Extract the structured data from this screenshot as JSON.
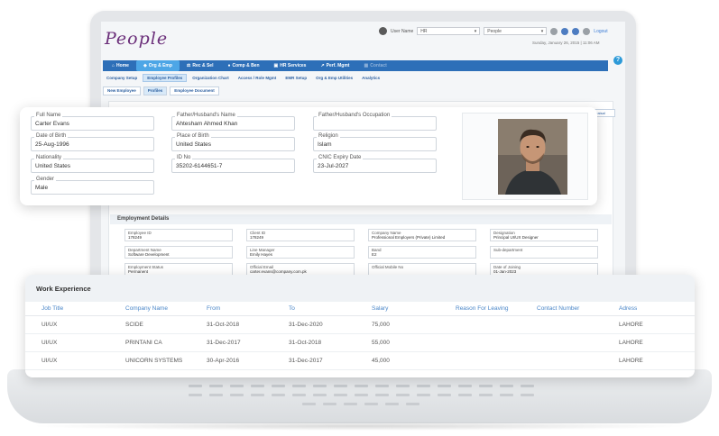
{
  "app": {
    "logo": "People",
    "user_label": "User Name",
    "lang_value": "HR",
    "module_value": "People",
    "logout": "Logout",
    "datetime": "Sunday, January 26, 2015 | 11:06 AM"
  },
  "nav": [
    {
      "icon": "home-icon",
      "label": "Home"
    },
    {
      "icon": "org-icon",
      "label": "Org & Emp"
    },
    {
      "icon": "scale-icon",
      "label": "Rec & Sel"
    },
    {
      "icon": "coins-icon",
      "label": "Comp & Ben"
    },
    {
      "icon": "briefcase-icon",
      "label": "HR Services"
    },
    {
      "icon": "chart-icon",
      "label": "Perf. Mgmt"
    },
    {
      "icon": "grid-icon",
      "label": "Contact"
    }
  ],
  "subnav": [
    "Company Setup",
    "Employee Profiles",
    "Organization Chart",
    "Access / Role Mgmt",
    "EMR Setup",
    "Org & Emp Utilities",
    "Analytics"
  ],
  "subsub": [
    "New Employee",
    "Profiles",
    "Employee Document"
  ],
  "right_tab": "Appraisal",
  "profile": {
    "full_name": {
      "label": "Full Name",
      "value": "Carter Evans"
    },
    "father_name": {
      "label": "Father/Husband's Name",
      "value": "Ahtesham Ahmed Khan"
    },
    "father_occupation": {
      "label": "Father/Husband's Occupation",
      "value": ""
    },
    "dob": {
      "label": "Date of Birth",
      "value": "25-Aug-1996"
    },
    "pob": {
      "label": "Place of Birth",
      "value": "United States"
    },
    "religion": {
      "label": "Religion",
      "value": "Islam"
    },
    "nationality": {
      "label": "Nationality",
      "value": "United States"
    },
    "id_no": {
      "label": "ID No",
      "value": "35202-6144651-7"
    },
    "cnic_expiry": {
      "label": "CNIC Expiry Date",
      "value": "23-Jul-2027"
    },
    "gender": {
      "label": "Gender",
      "value": "Male"
    }
  },
  "employment": {
    "title": "Employment Details",
    "fields": [
      {
        "label": "Employee ID",
        "value": "178249"
      },
      {
        "label": "Client ID",
        "value": "178249"
      },
      {
        "label": "Company Name",
        "value": "Professional Employers (Private) Limited"
      },
      {
        "label": "Designation",
        "value": "Principal UI/UX Designer"
      },
      {
        "label": "Department Name",
        "value": "Software Development"
      },
      {
        "label": "Line Manager",
        "value": "Emily Hayes"
      },
      {
        "label": "Band",
        "value": "E2"
      },
      {
        "label": "Sub-department",
        "value": ""
      },
      {
        "label": "Employment Status",
        "value": "Permanent"
      },
      {
        "label": "Official Email",
        "value": "carter.evans@company.com.pk"
      },
      {
        "label": "Official Mobile No",
        "value": ""
      },
      {
        "label": "Date of Joining",
        "value": "01-Jan-2023"
      }
    ]
  },
  "work": {
    "title": "Work Experience",
    "headers": [
      "Job Title",
      "Company Name",
      "From",
      "To",
      "Salary",
      "Reason For Leaving",
      "Contact Number",
      "Adress"
    ],
    "rows": [
      [
        "UI/UX",
        "SCIDE",
        "31-Oct-2018",
        "31-Dec-2020",
        "75,000",
        "",
        "",
        "LAHORE"
      ],
      [
        "UI/UX",
        "PRINTANI CA",
        "31-Dec-2017",
        "31-Oct-2018",
        "55,000",
        "",
        "",
        "LAHORE"
      ],
      [
        "UI/UX",
        "UNICORN SYSTEMS",
        "30-Apr-2016",
        "31-Dec-2017",
        "45,000",
        "",
        "",
        "LAHORE"
      ]
    ]
  }
}
